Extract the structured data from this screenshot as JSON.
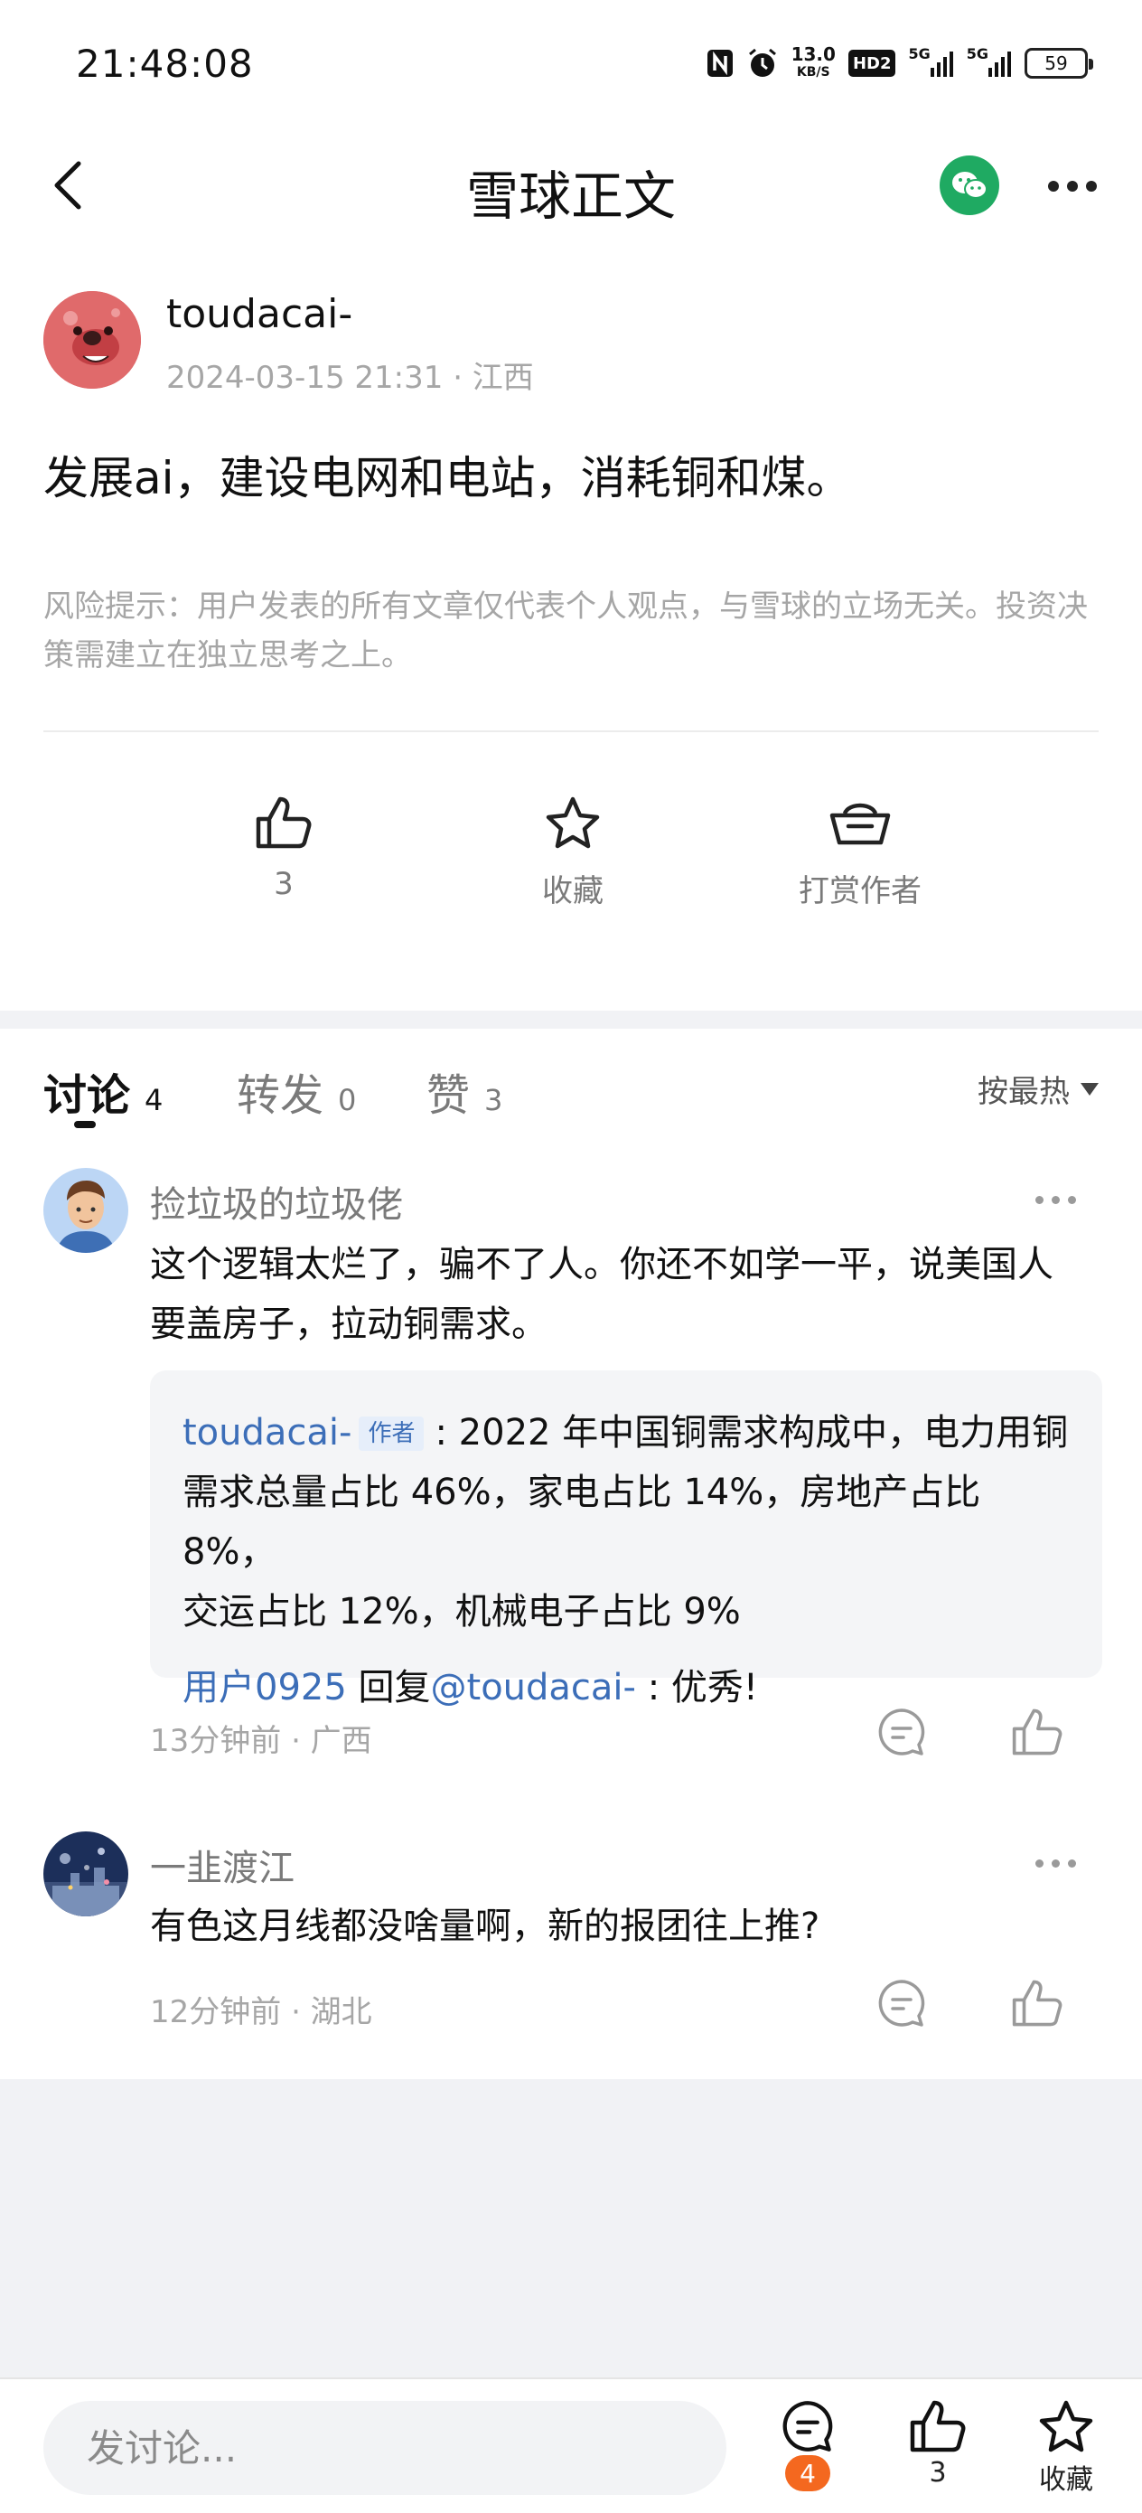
{
  "status_bar": {
    "time": "21:48:08",
    "net_speed_value": "13.0",
    "net_speed_unit": "KB/S",
    "hd_label": "HD2",
    "signal1_label": "5G",
    "signal2_label": "5G",
    "battery": "59"
  },
  "nav": {
    "title": "雪球正文"
  },
  "post": {
    "author_name": "toudacai-",
    "meta": "2024-03-15 21:31 · 江西",
    "content": "发展ai，建设电网和电站，消耗铜和煤。",
    "risk_note": "风险提示：用户发表的所有文章仅代表个人观点，与雪球的立场无关。投资决策需建立在独立思考之上。"
  },
  "actions": {
    "like_count": "3",
    "favorite_label": "收藏",
    "reward_label": "打赏作者"
  },
  "tabs": [
    {
      "label": "讨论",
      "count": "4"
    },
    {
      "label": "转发",
      "count": "0"
    },
    {
      "label": "赞",
      "count": "3"
    }
  ],
  "sort_label": "按最热",
  "comments": [
    {
      "user": "捡垃圾的垃圾佬",
      "text_line1": "这个逻辑太烂了，骗不了人。你还不如学一平，说美国人",
      "text_line2": "要盖房子，拉动铜需求。",
      "reply": {
        "author": "toudacai-",
        "author_tag": "作者",
        "line1": ": 2022 年中国铜需求构成中，电力用铜",
        "line2": "需求总量占比 46%，家电占比 14%，房地产占比 8%，",
        "line3": "交运占比 12%，机械电子占比 9%",
        "sub_user": "用户0925",
        "sub_reply_word": " 回复",
        "sub_mention": "@toudacai-",
        "sub_text": " : 优秀!"
      },
      "meta": "13分钟前 · 广西"
    },
    {
      "user": "一韭渡江",
      "text_line1": "有色这月线都没啥量啊，新的报团往上推?",
      "meta": "12分钟前 · 湖北"
    }
  ],
  "bottom_bar": {
    "input_placeholder": "发讨论...",
    "comment_badge": "4",
    "like_count": "3",
    "favorite_label": "收藏"
  },
  "colors": {
    "accent_blue": "#3c6eb8",
    "wechat_green": "#1faa62",
    "badge_orange": "#f4681f",
    "meta_gray": "#a6a6a6"
  },
  "icons": [
    "back-icon",
    "wechat-icon",
    "more-icon",
    "thumbs-up-icon",
    "star-icon",
    "reward-basket-icon",
    "comment-icon",
    "triangle-down-icon"
  ]
}
